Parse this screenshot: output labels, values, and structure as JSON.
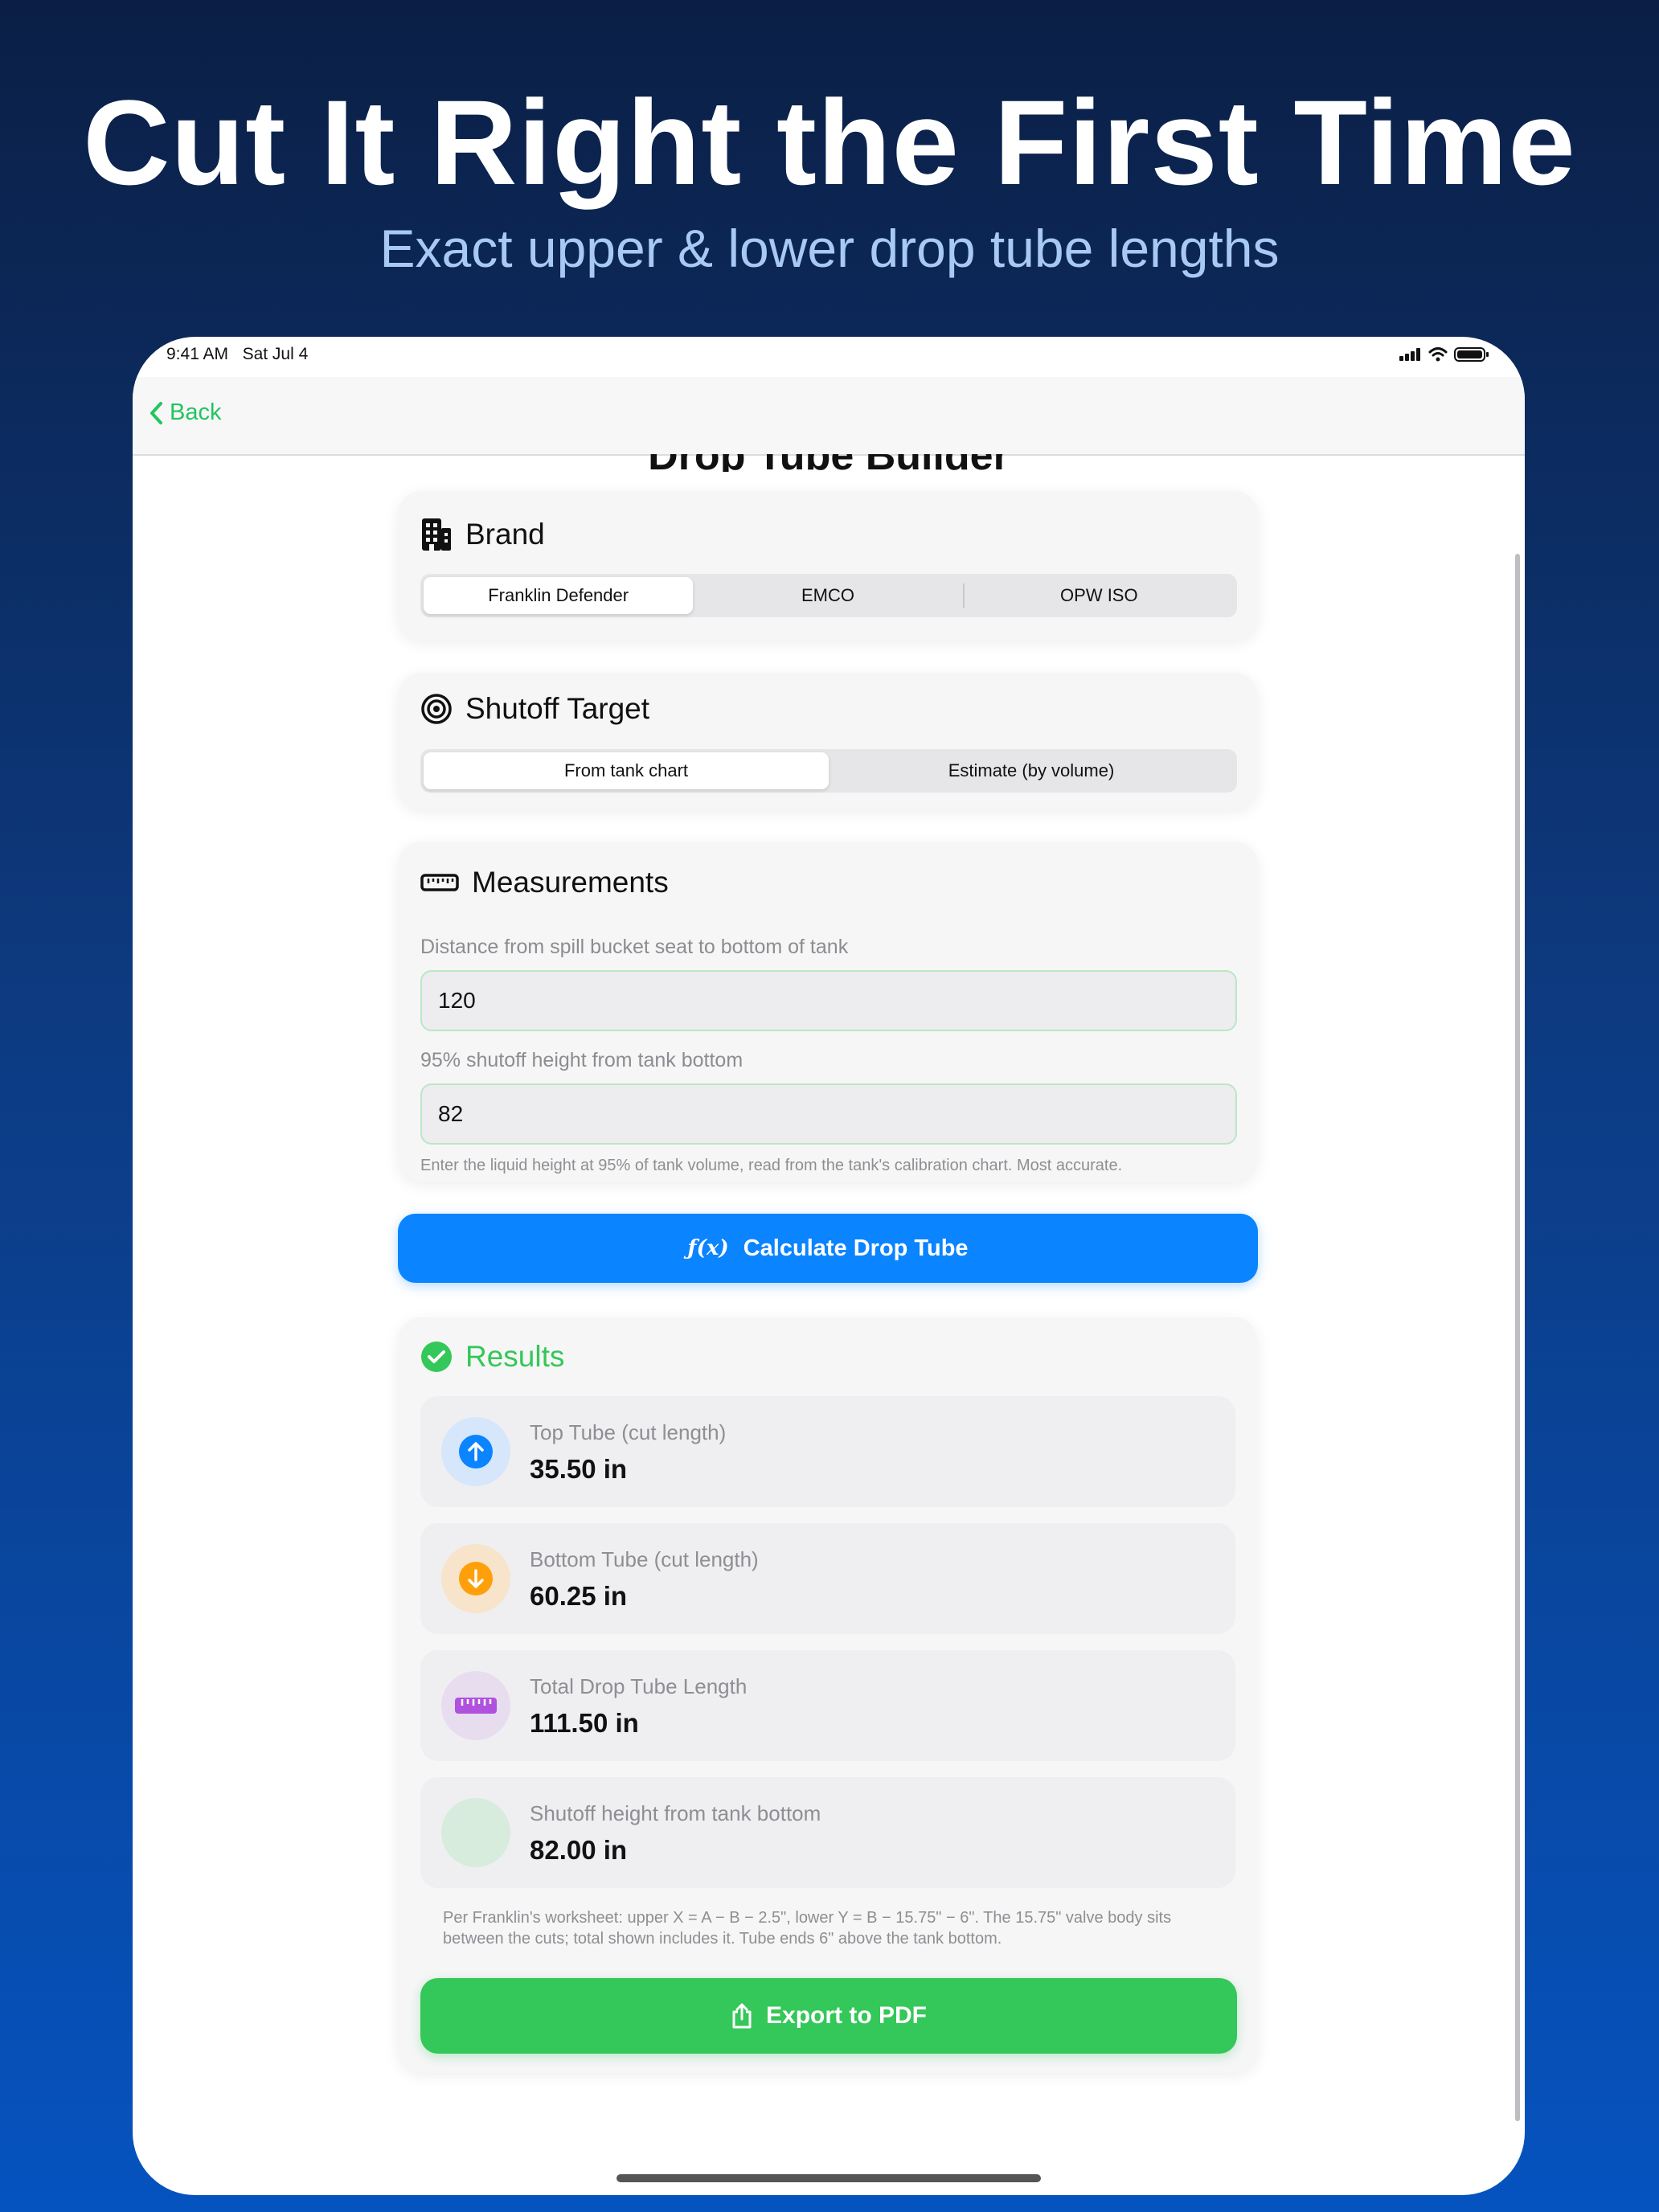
{
  "promo": {
    "headline": "Cut It Right the First Time",
    "subheadline": "Exact upper & lower drop tube lengths"
  },
  "status_bar": {
    "time": "9:41 AM",
    "date": "Sat Jul 4"
  },
  "nav": {
    "back_label": "Back",
    "title": "Drop Tube Builder"
  },
  "brand": {
    "title": "Brand",
    "options": [
      "Franklin Defender",
      "EMCO",
      "OPW ISO"
    ],
    "selected": "Franklin Defender"
  },
  "shutoff": {
    "title": "Shutoff Target",
    "options": [
      "From tank chart",
      "Estimate (by volume)"
    ],
    "selected": "From tank chart"
  },
  "measurements": {
    "title": "Measurements",
    "distance_label": "Distance from spill bucket seat to bottom of tank",
    "distance_value": "120",
    "shutoff_label": "95% shutoff height from tank bottom",
    "shutoff_value": "82",
    "hint": "Enter the liquid height at 95% of tank volume, read from the tank's calibration chart. Most accurate."
  },
  "calculate": {
    "icon": "ƒ(x)",
    "label": "Calculate Drop Tube"
  },
  "results": {
    "title": "Results",
    "items": [
      {
        "label": "Top Tube (cut length)",
        "value": "35.50 in",
        "icon": "arrow-up-icon",
        "color": "#0a84ff"
      },
      {
        "label": "Bottom Tube (cut length)",
        "value": "60.25 in",
        "icon": "arrow-down-icon",
        "color": "#ff9f0a"
      },
      {
        "label": "Total Drop Tube Length",
        "value": "111.50 in",
        "icon": "ruler-icon",
        "color": "#af52de"
      },
      {
        "label": "Shutoff height from tank bottom",
        "value": "82.00 in",
        "icon": "circle-icon",
        "color": "#34c759"
      }
    ],
    "note": "Per Franklin's worksheet: upper X = A − B − 2.5\", lower Y = B − 15.75\" − 6\". The 15.75\" valve body sits between the cuts; total shown includes it. Tube ends 6\" above the tank bottom.",
    "export_label": "Export to PDF"
  },
  "colors": {
    "accent_blue": "#0a84ff",
    "accent_green": "#34c759",
    "back_green": "#22c55e"
  }
}
